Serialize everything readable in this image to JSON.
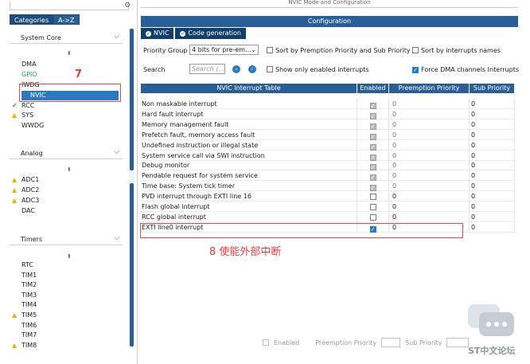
{
  "left": {
    "tabs": [
      "Categories",
      "A->Z"
    ],
    "sections": [
      {
        "title": "System Core",
        "items": [
          {
            "label": "DMA",
            "status": "none"
          },
          {
            "label": "GPIO",
            "status": "green"
          },
          {
            "label": "IWDG",
            "status": "none"
          },
          {
            "label": "NVIC",
            "status": "selected"
          },
          {
            "label": "RCC",
            "status": "check"
          },
          {
            "label": "SYS",
            "status": "warn"
          },
          {
            "label": "WWDG",
            "status": "none"
          }
        ]
      },
      {
        "title": "Analog",
        "items": [
          {
            "label": "ADC1",
            "status": "warn"
          },
          {
            "label": "ADC2",
            "status": "warn"
          },
          {
            "label": "ADC3",
            "status": "warn"
          },
          {
            "label": "DAC",
            "status": "none"
          }
        ]
      },
      {
        "title": "Timers",
        "items": [
          {
            "label": "RTC",
            "status": "none"
          },
          {
            "label": "TIM1",
            "status": "none"
          },
          {
            "label": "TIM2",
            "status": "none"
          },
          {
            "label": "TIM3",
            "status": "none"
          },
          {
            "label": "TIM4",
            "status": "none"
          },
          {
            "label": "TIM5",
            "status": "warn"
          },
          {
            "label": "TIM6",
            "status": "none"
          },
          {
            "label": "TIM7",
            "status": "none"
          },
          {
            "label": "TIM8",
            "status": "warn"
          }
        ]
      }
    ],
    "annotation_7": "7"
  },
  "right": {
    "top_title": "NVIC Mode and Configuration",
    "config_title": "Configuration",
    "subtabs": [
      "NVIC",
      "Code generation"
    ],
    "priority_group_label": "Priority Group",
    "priority_group_value": "4 bits for pre-em...",
    "sort_prio_label": "Sort by Premption Priority and Sub Priority",
    "sort_int_label": "Sort by interrupts names",
    "search_label": "Search",
    "search_placeholder": "Search (...",
    "show_enabled_label": "Show only enabled interrupts",
    "force_dma_label": "Force DMA channels Interrupts",
    "table_headers": [
      "NVIC Interrupt Table",
      "Enabled",
      "Preemption Priority",
      "Sub Priority"
    ],
    "rows": [
      {
        "name": "Non maskable interrupt",
        "enabled": "locked",
        "pre": "0",
        "sub": "0",
        "grey": true
      },
      {
        "name": "Hard fault interrupt",
        "enabled": "locked",
        "pre": "0",
        "sub": "0",
        "grey": true
      },
      {
        "name": "Memory management fault",
        "enabled": "locked",
        "pre": "0",
        "sub": "0",
        "grey": false
      },
      {
        "name": "Prefetch fault, memory access fault",
        "enabled": "locked",
        "pre": "0",
        "sub": "0",
        "grey": false
      },
      {
        "name": "Undefined instruction or illegal state",
        "enabled": "locked",
        "pre": "0",
        "sub": "0",
        "grey": false
      },
      {
        "name": "System service call via SWI instruction",
        "enabled": "locked",
        "pre": "0",
        "sub": "0",
        "grey": false
      },
      {
        "name": "Debug monitor",
        "enabled": "locked",
        "pre": "0",
        "sub": "0",
        "grey": false
      },
      {
        "name": "Pendable request for system service",
        "enabled": "locked",
        "pre": "0",
        "sub": "0",
        "grey": false
      },
      {
        "name": "Time base: System tick timer",
        "enabled": "locked",
        "pre": "0",
        "sub": "0",
        "grey": false
      },
      {
        "name": "PVD interrupt through EXTI line 16",
        "enabled": "off",
        "pre": "0",
        "sub": "0",
        "grey": false
      },
      {
        "name": "Flash global interrupt",
        "enabled": "off",
        "pre": "0",
        "sub": "0",
        "grey": false
      },
      {
        "name": "RCC global interrupt",
        "enabled": "off",
        "pre": "0",
        "sub": "0",
        "grey": false
      },
      {
        "name": "EXTI line0 interrupt",
        "enabled": "on",
        "pre": "0",
        "sub": "0",
        "grey": false
      }
    ],
    "annotation_8": "8 使能外部中断",
    "bottom": {
      "enabled": "Enabled",
      "preemption": "Preemption Priority",
      "sub": "Sub Priority"
    }
  },
  "watermark_text": "ST中文论坛"
}
